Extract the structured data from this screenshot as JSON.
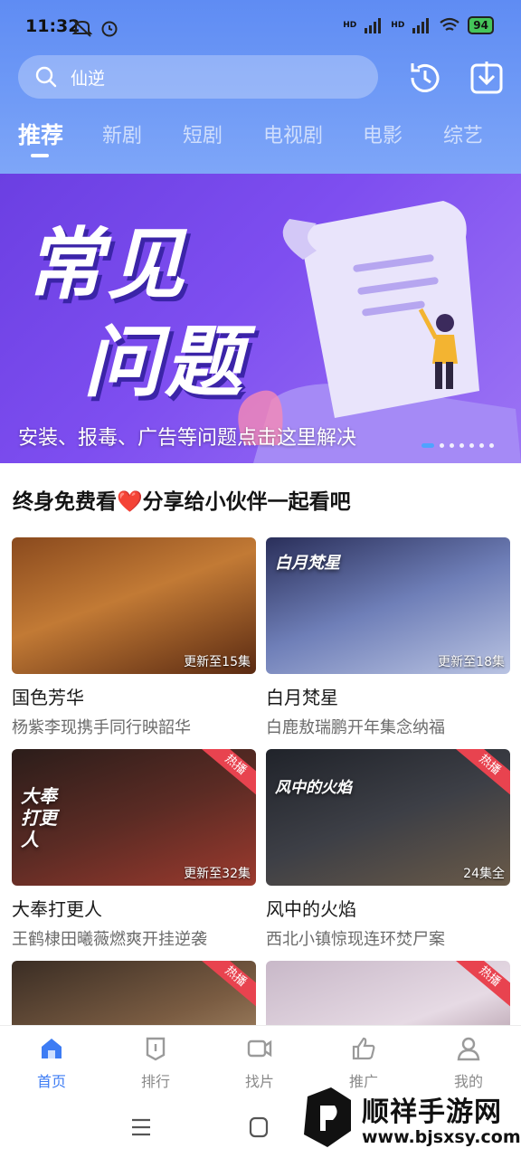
{
  "status_bar": {
    "time": "11:32",
    "battery": "94",
    "net1": "HD",
    "net2": "HD"
  },
  "search": {
    "query": "仙逆"
  },
  "tabs": [
    {
      "label": "推荐",
      "active": true
    },
    {
      "label": "新剧"
    },
    {
      "label": "短剧"
    },
    {
      "label": "电视剧"
    },
    {
      "label": "电影"
    },
    {
      "label": "综艺"
    }
  ],
  "banner": {
    "line1": "常见",
    "line2": "问题",
    "caption": "安装、报毒、广告等问题点击这里解决",
    "dots": 7,
    "active_dot": 0
  },
  "section": {
    "title": "终身免费看❤️分享给小伙伴一起看吧"
  },
  "cards": [
    {
      "title": "国色芳华",
      "subtitle": "杨紫李现携手同行映韶华",
      "episodes": "更新至15集",
      "tag": "",
      "poster_text": ""
    },
    {
      "title": "白月梵星",
      "subtitle": "白鹿敖瑞鹏开年集念纳福",
      "episodes": "更新至18集",
      "tag": "",
      "poster_text": "白月梵星"
    },
    {
      "title": "大奉打更人",
      "subtitle": "王鹤棣田曦薇燃爽开挂逆袭",
      "episodes": "更新至32集",
      "tag": "热播",
      "poster_text": "大奉打更人"
    },
    {
      "title": "风中的火焰",
      "subtitle": "西北小镇惊现连环焚尸案",
      "episodes": "24集全",
      "tag": "热播",
      "poster_text": "风中的火焰"
    },
    {
      "title": "",
      "subtitle": "",
      "episodes": "",
      "tag": "热播",
      "poster_text": ""
    },
    {
      "title": "",
      "subtitle": "",
      "episodes": "",
      "tag": "热播",
      "poster_text": ""
    }
  ],
  "bottom_tabs": [
    {
      "label": "首页",
      "icon": "home-icon",
      "active": true
    },
    {
      "label": "排行",
      "icon": "ranking-icon"
    },
    {
      "label": "找片",
      "icon": "video-icon"
    },
    {
      "label": "推广",
      "icon": "thumbs-up-icon"
    },
    {
      "label": "我的",
      "icon": "user-icon"
    }
  ],
  "watermark": {
    "name": "顺祥手游网",
    "url": "www.bjsxsy.com"
  },
  "colors": {
    "accent": "#3d7cf4",
    "header": "#6a95f5",
    "banner": "#7a4cee",
    "tag": "#e8434f"
  }
}
